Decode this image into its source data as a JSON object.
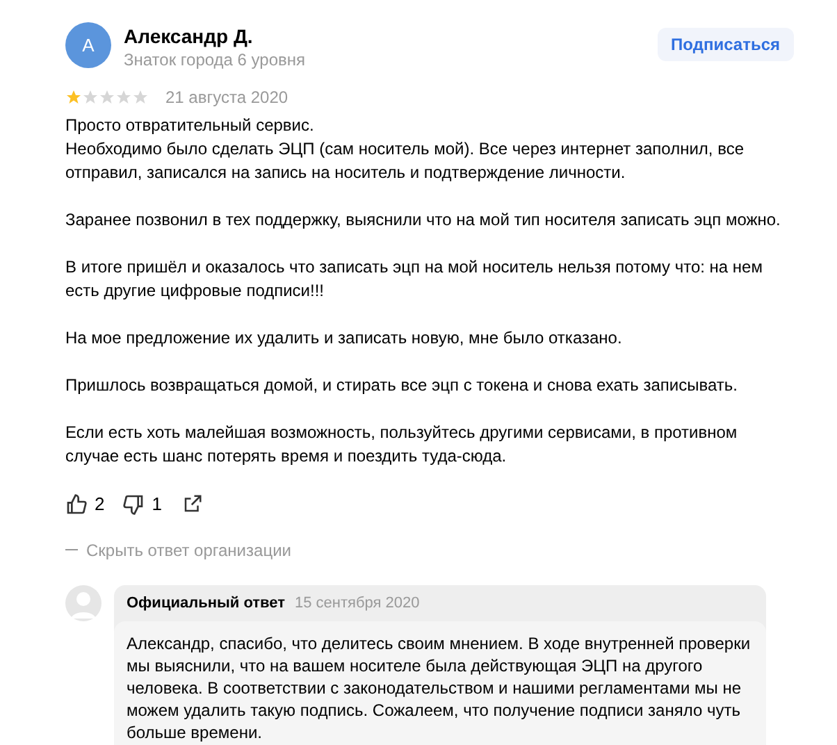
{
  "author": {
    "initial": "А",
    "name": "Александр Д.",
    "status": "Знаток города 6 уровня"
  },
  "subscribe_button": "Подписаться",
  "rating": {
    "stars": 1
  },
  "date": "21 августа 2020",
  "paragraphs": [
    {
      "lines": [
        "Просто отвратительный сервис.",
        "Необходимо было сделать ЭЦП (сам носитель мой). Все через интернет заполнил, все отправил, записался на запись на носитель и подтверждение личности."
      ]
    },
    {
      "lines": [
        "Заранее позвонил в тех поддержку, выяснили что на мой тип носителя записать эцп можно."
      ]
    },
    {
      "lines": [
        "В итоге пришёл и оказалось что записать эцп на мой носитель нельзя потому что: на нем есть другие цифровые подписи!!!"
      ]
    },
    {
      "lines": [
        "На мое предложение их удалить и записать новую, мне было отказано."
      ]
    },
    {
      "lines": [
        "Пришлось возвращаться домой, и стирать все эцп с токена и снова ехать записывать."
      ]
    },
    {
      "lines": [
        "Если есть хоть малейшая возможность, пользуйтесь другими сервисами, в противном случае есть шанс потерять время и поездить туда-сюда."
      ]
    }
  ],
  "likes": "2",
  "dislikes": "1",
  "hide_reply_link": "Скрыть ответ организации",
  "reply": {
    "title": "Официальный ответ",
    "date": "15 сентября 2020",
    "text": "Александр, спасибо, что делитесь своим мнением. В ходе внутренней проверки мы выяснили, что на вашем носителе была действующая ЭЦП на другого человека. В соответствии с законодательством и нашими регламентами мы не можем удалить такую подпись. Сожалеем, что получение подписи заняло чуть больше времени."
  }
}
